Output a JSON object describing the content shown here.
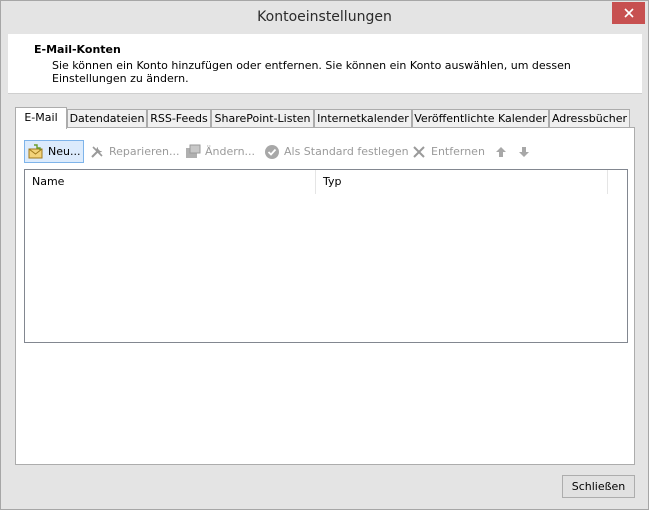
{
  "window": {
    "title": "Kontoeinstellungen"
  },
  "header": {
    "title": "E-Mail-Konten",
    "description": "Sie können ein Konto hinzufügen oder entfernen. Sie können ein Konto auswählen, um dessen Einstellungen zu ändern."
  },
  "tabs": [
    {
      "label": "E-Mail",
      "active": true
    },
    {
      "label": "Datendateien",
      "active": false
    },
    {
      "label": "RSS-Feeds",
      "active": false
    },
    {
      "label": "SharePoint-Listen",
      "active": false
    },
    {
      "label": "Internetkalender",
      "active": false
    },
    {
      "label": "Veröffentlichte Kalender",
      "active": false
    },
    {
      "label": "Adressbücher",
      "active": false
    }
  ],
  "toolbar": {
    "new_label": "Neu...",
    "repair_label": "Reparieren...",
    "change_label": "Ändern...",
    "default_label": "Als Standard festlegen",
    "remove_label": "Entfernen",
    "up_icon": "arrow-up-icon",
    "down_icon": "arrow-down-icon"
  },
  "accounts_list": {
    "columns": [
      "Name",
      "Typ"
    ],
    "rows": []
  },
  "footer": {
    "close_label": "Schließen"
  },
  "colors": {
    "close_red": "#c75050",
    "selection_blue": "#dcebfc",
    "disabled_gray": "#9a9a9a"
  }
}
